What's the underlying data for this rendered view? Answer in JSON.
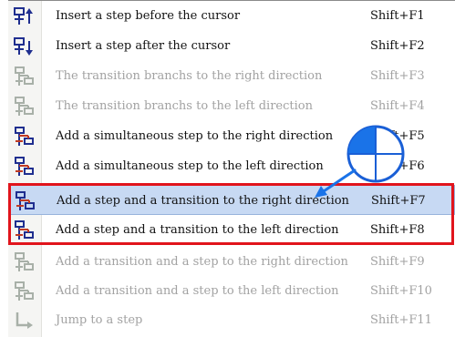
{
  "menu": {
    "items": [
      {
        "label": "Insert a step before the cursor",
        "shortcut": "Shift+F1",
        "icon": "insert-step-before-icon",
        "enabled": true,
        "highlighted": false
      },
      {
        "label": "Insert a step after the cursor",
        "shortcut": "Shift+F2",
        "icon": "insert-step-after-icon",
        "enabled": true,
        "highlighted": false
      },
      {
        "label": "The transition branchs to the right direction",
        "shortcut": "Shift+F3",
        "icon": "transition-branch-right-icon",
        "enabled": false,
        "highlighted": false
      },
      {
        "label": "The transition branchs to the left direction",
        "shortcut": "Shift+F4",
        "icon": "transition-branch-left-icon",
        "enabled": false,
        "highlighted": false
      },
      {
        "label": "Add a simultaneous step to the right direction",
        "shortcut": "Shift+F5",
        "icon": "simultaneous-step-right-icon",
        "enabled": true,
        "highlighted": false
      },
      {
        "label": "Add a simultaneous step to the left direction",
        "shortcut": "Shift+F6",
        "icon": "simultaneous-step-left-icon",
        "enabled": true,
        "highlighted": false
      },
      {
        "label": "Add a step and a transition to the right direction",
        "shortcut": "Shift+F7",
        "icon": "step-transition-right-icon",
        "enabled": true,
        "highlighted": true
      },
      {
        "label": "Add a step and a transition to the left direction",
        "shortcut": "Shift+F8",
        "icon": "step-transition-left-icon",
        "enabled": true,
        "highlighted": false
      },
      {
        "label": "Add a transition and a step to the right direction",
        "shortcut": "Shift+F9",
        "icon": "transition-step-right-icon",
        "enabled": false,
        "highlighted": false
      },
      {
        "label": "Add a transition and a step to the left direction",
        "shortcut": "Shift+F10",
        "icon": "transition-step-left-icon",
        "enabled": false,
        "highlighted": false
      },
      {
        "label": "Jump to a step",
        "shortcut": "Shift+F11",
        "icon": "jump-to-step-icon",
        "enabled": false,
        "highlighted": false
      }
    ]
  },
  "annotation": {
    "icon": "mouse-click-icon",
    "box_color": "#e1141c",
    "arrow_color": "#1a73e8"
  },
  "colors": {
    "icon_enabled": "#1f2e8f",
    "icon_enabled_alt": "#c03a22",
    "icon_disabled": "#a8b0a8",
    "highlight": "#c7d9f3"
  }
}
